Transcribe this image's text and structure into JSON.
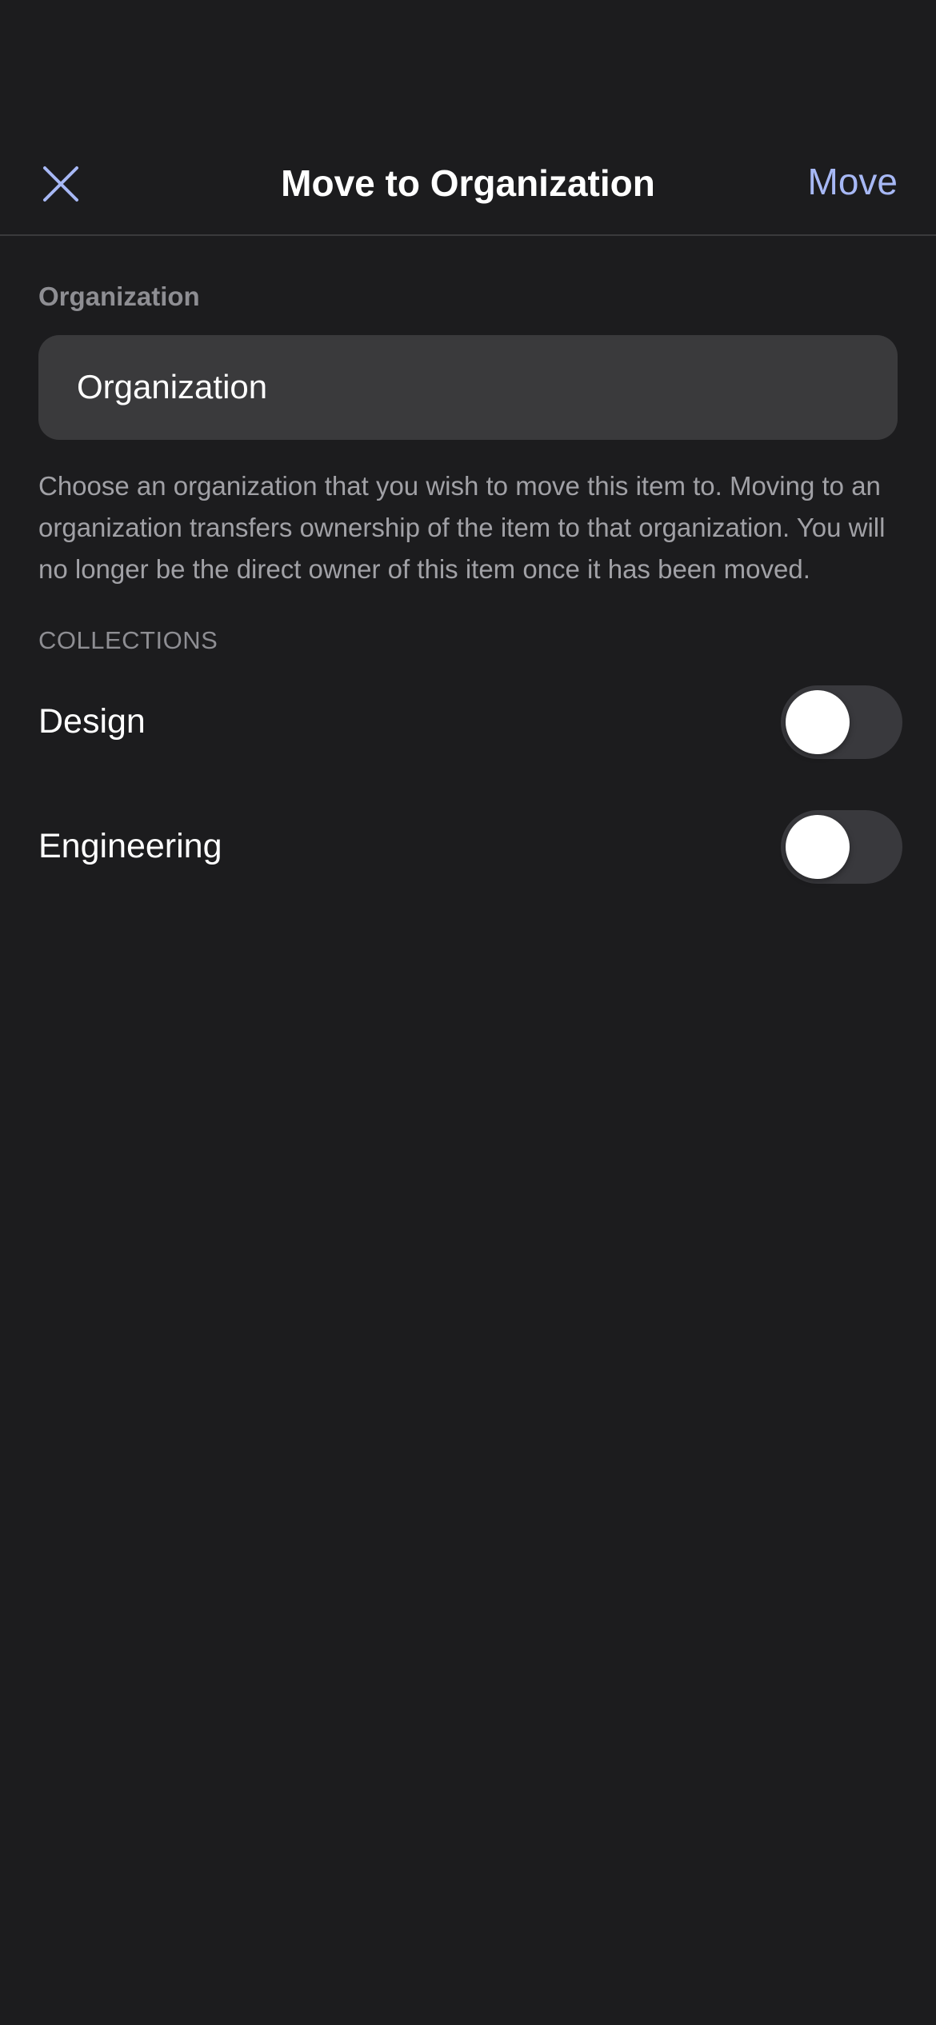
{
  "nav": {
    "title": "Move to Organization",
    "close_icon": "close-icon",
    "move_label": "Move"
  },
  "form": {
    "organization_label": "Organization",
    "organization_value": "Organization",
    "help_text": "Choose an organization that you wish to move this item to. Moving to an organization transfers ownership of the item to that organization. You will no longer be the direct owner of this item once it has been moved."
  },
  "collections": {
    "header": "COLLECTIONS",
    "items": [
      {
        "label": "Design",
        "enabled": false
      },
      {
        "label": "Engineering",
        "enabled": false
      }
    ]
  },
  "colors": {
    "background": "#1c1c1e",
    "accent": "#a7b8f5",
    "field_background": "#3a3a3c",
    "toggle_off": "#39393d"
  }
}
